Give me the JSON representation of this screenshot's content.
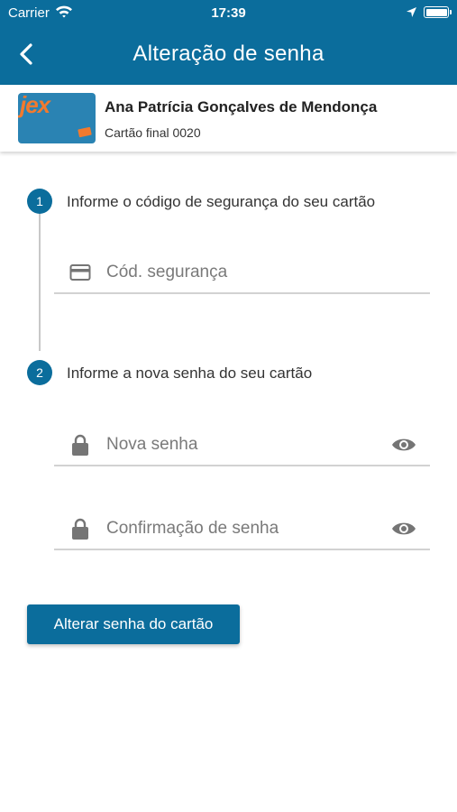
{
  "status_bar": {
    "carrier": "Carrier",
    "time": "17:39",
    "icons": [
      "wifi-icon",
      "location-icon",
      "battery-icon"
    ]
  },
  "nav": {
    "back_icon": "chevron-left-icon",
    "title": "Alteração de senha"
  },
  "card": {
    "brand": "jex",
    "holder_name": "Ana Patrícia Gonçalves de Mendonça",
    "card_number": "Cartão final 0020"
  },
  "steps": [
    {
      "number": "1",
      "text": "Informe o código de segurança do seu cartão",
      "fields": [
        {
          "icon": "credit-card-icon",
          "value": "",
          "placeholder": "Cód. segurança"
        }
      ]
    },
    {
      "number": "2",
      "text": "Informe a nova senha do seu cartão",
      "fields": [
        {
          "icon": "lock-icon",
          "value": "",
          "placeholder": "Nova senha",
          "toggle_icon": "eye-icon"
        },
        {
          "icon": "lock-icon",
          "value": "",
          "placeholder": "Confirmação de senha",
          "toggle_icon": "eye-icon"
        }
      ]
    }
  ],
  "submit_label": "Alterar senha do cartão",
  "colors": {
    "primary": "#0b6d9c",
    "accent": "#f27a2e",
    "divider": "#d2d2d2",
    "icon": "#757575"
  }
}
